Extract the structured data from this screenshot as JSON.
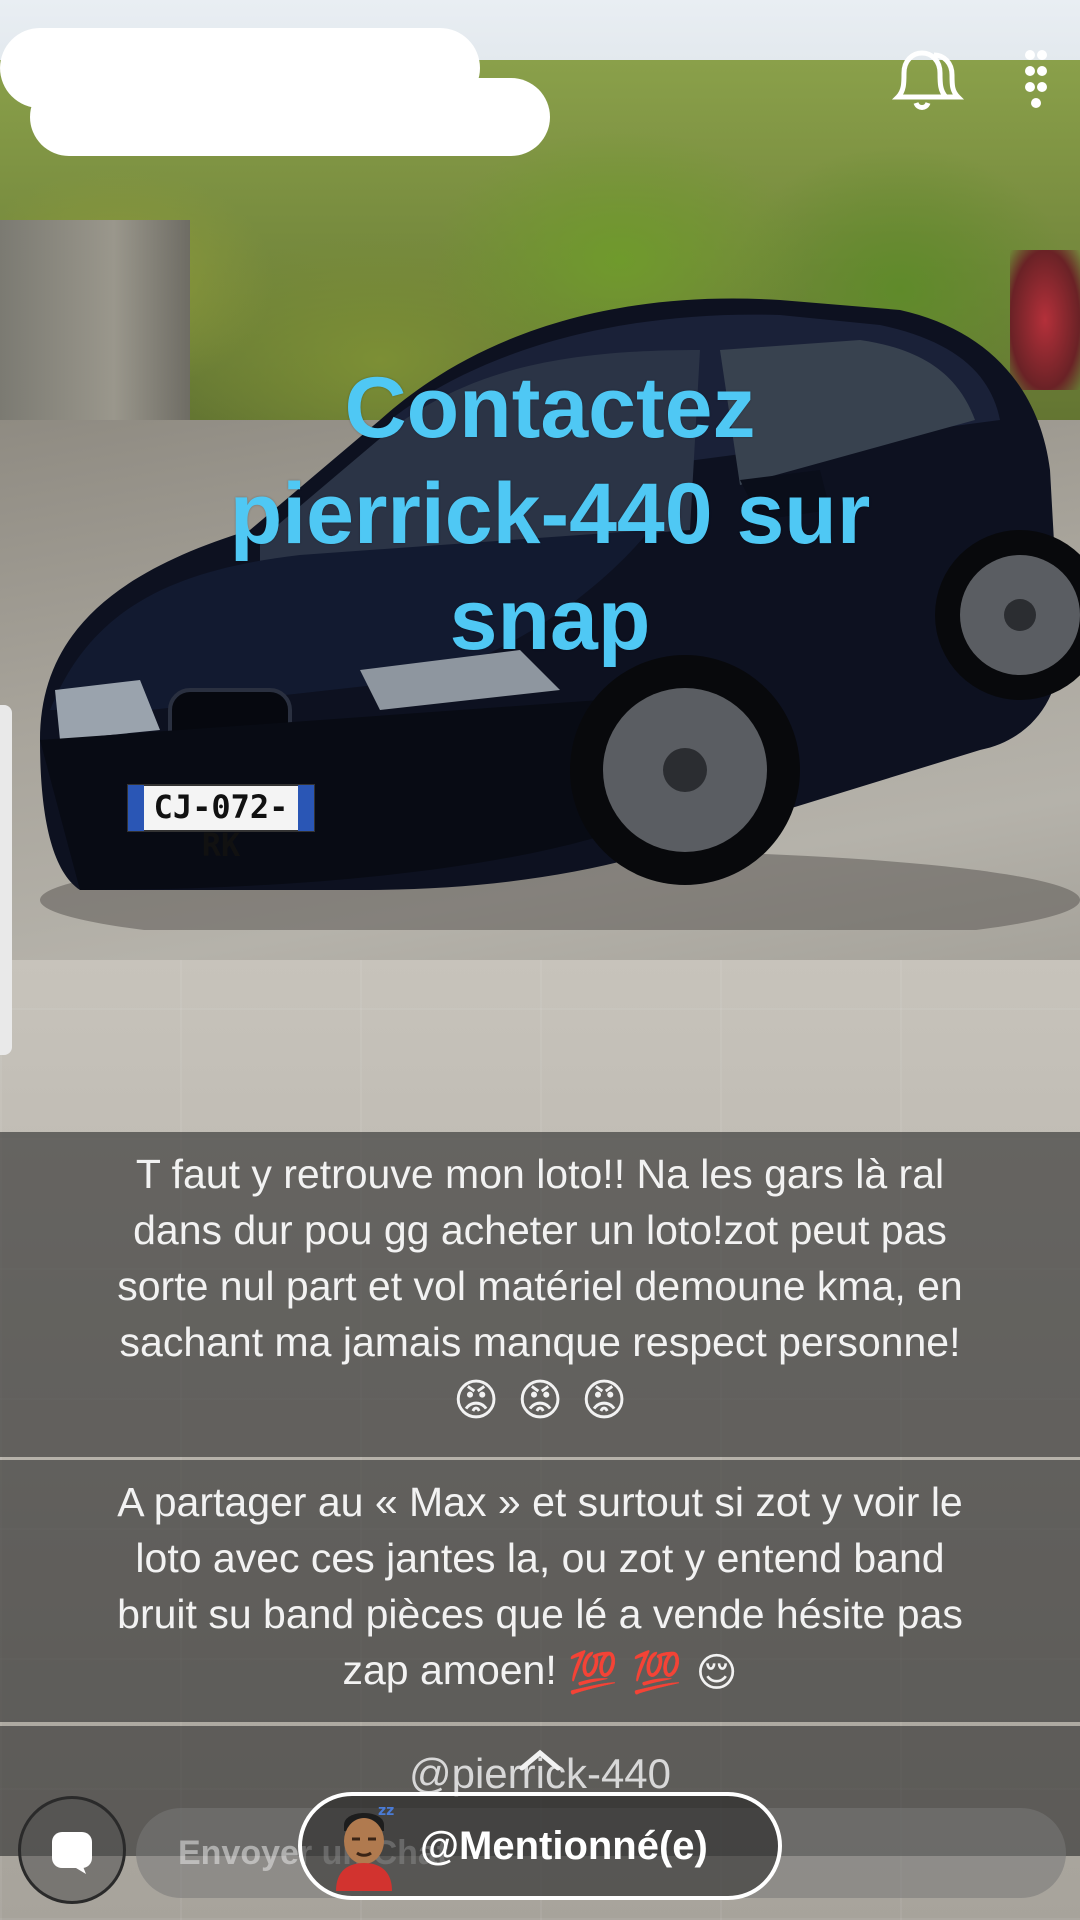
{
  "overlay": {
    "line1": "Contactez",
    "line2": "pierrick-440 sur",
    "line3": "snap"
  },
  "photo": {
    "license_plate": "CJ-072-RK"
  },
  "captions": {
    "first": {
      "line1": "T faut y retrouve mon loto!! Na les gars là ral",
      "line2": "dans dur pou gg acheter un loto!zot peut pas",
      "line3": "sorte nul part et vol matériel demoune kma, en",
      "line4": "sachant ma jamais manque respect personne!",
      "emojis": [
        "😡",
        "😡",
        "😡"
      ]
    },
    "second": {
      "line1": "A partager au « Max » et surtout si zot y voir le",
      "line2": "loto avec ces jantes la, ou zot y entend band",
      "line3": "bruit su band pièces que lé a vende hésite pas",
      "line4": "zap amoen!",
      "emojis": [
        "💯",
        "💯",
        "😌"
      ]
    },
    "mention": "@pierrick-440"
  },
  "bottom_bar": {
    "reply_placeholder": "Envoyer un Chat",
    "mention_button": "@Mentionné(e)"
  },
  "icons": {
    "top_right": [
      "notification-bell-icon",
      "more-dots-icon"
    ],
    "bottom_left": "camera-icon",
    "avatar": "bitmoji-avatar"
  },
  "colors": {
    "overlay_text": "#4fc8f4",
    "caption_background": "#2d2d2d"
  }
}
